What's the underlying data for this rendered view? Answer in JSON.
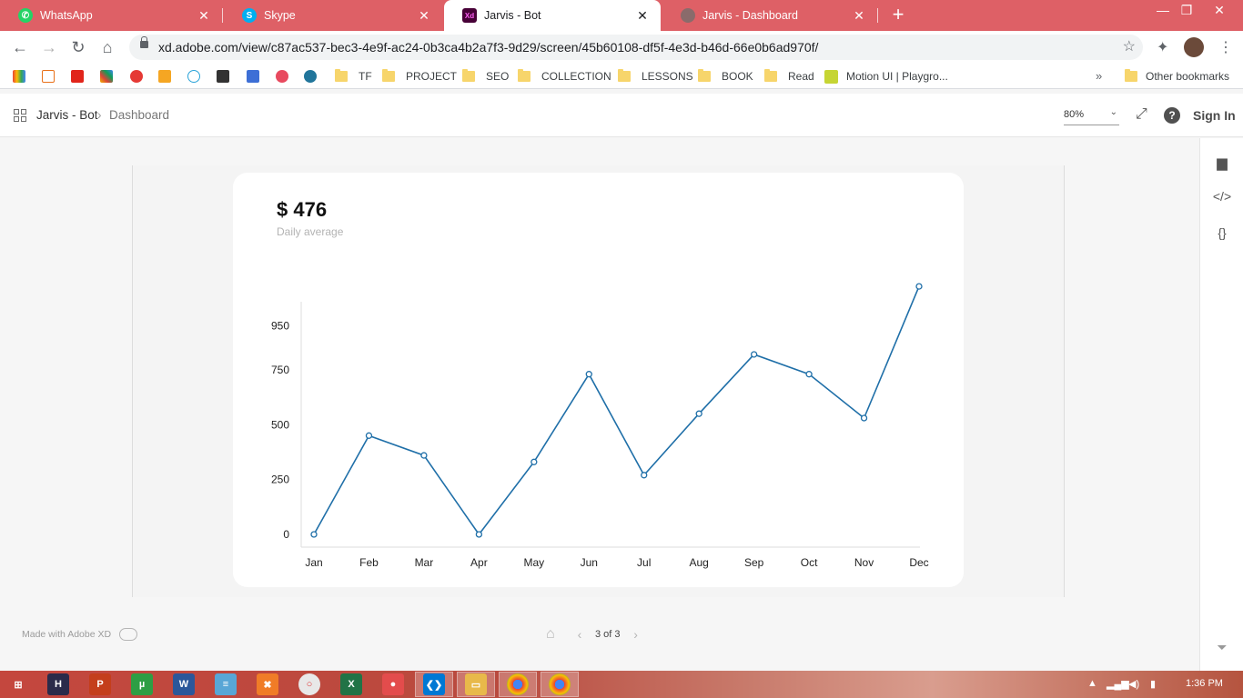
{
  "browser": {
    "tabs": [
      {
        "label": "WhatsApp",
        "icon": "whatsapp-icon",
        "color": "#25d366"
      },
      {
        "label": "Skype",
        "icon": "skype-icon",
        "color": "#00aff0"
      },
      {
        "label": "Jarvis - Bot",
        "icon": "adobe-xd-icon",
        "color": "#470137"
      },
      {
        "label": "Jarvis - Dashboard",
        "icon": "dashboard-icon",
        "color": "#8a6b6b"
      }
    ],
    "url": "xd.adobe.com/view/c87ac537-bec3-4e9f-ac24-0b3ca4b2a7f3-9d29/screen/45b60108-df5f-4e3d-b46d-66e0b6ad970f/",
    "bookmark_folders": [
      "TF",
      "PROJECT",
      "SEO",
      "COLLECTION",
      "LESSONS",
      "BOOK",
      "Read"
    ],
    "bookmark_link": "Motion UI | Playgro...",
    "other_bookmarks": "Other bookmarks"
  },
  "xd": {
    "breadcrumb_project": "Jarvis - Bot",
    "breadcrumb_sep": "›",
    "breadcrumb_screen": "Dashboard",
    "zoom": "80%",
    "sign_in": "Sign In",
    "made_with": "Made with Adobe XD",
    "page_indicator": "3 of 3"
  },
  "card": {
    "value": "$ 476",
    "subtitle": "Daily average"
  },
  "chart_data": {
    "type": "line",
    "categories": [
      "Jan",
      "Feb",
      "Mar",
      "Apr",
      "May",
      "Jun",
      "Jul",
      "Aug",
      "Sep",
      "Oct",
      "Nov",
      "Dec"
    ],
    "series": [
      {
        "values": [
          0,
          450,
          360,
          0,
          330,
          730,
          270,
          550,
          820,
          730,
          530,
          1130
        ]
      }
    ],
    "yticks": [
      0,
      250,
      500,
      750,
      950
    ],
    "ylim": [
      0,
      1130
    ],
    "grid": false,
    "line_color": "#1f6fa8"
  },
  "taskbar": {
    "clock": "1:36 PM"
  }
}
